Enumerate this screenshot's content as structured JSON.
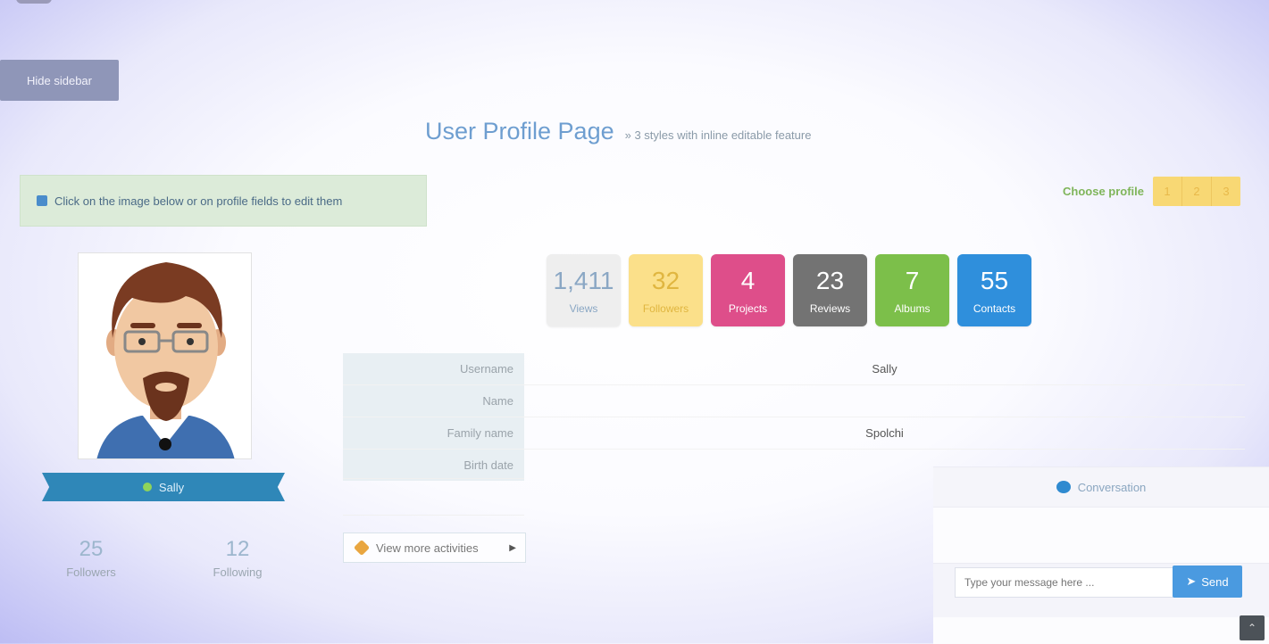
{
  "sidebar_toggle": {
    "label": "Hide sidebar"
  },
  "header": {
    "title": "User Profile Page",
    "subtitle": "» 3 styles with inline editable feature"
  },
  "alert": {
    "text": "Click on the image below or on profile fields to edit them"
  },
  "profile_switch": {
    "label": "Choose profile",
    "options": [
      "1",
      "2",
      "3"
    ]
  },
  "user": {
    "username": "Sally",
    "followers_count": "25",
    "followers_label": "Followers",
    "following_count": "12",
    "following_label": "Following"
  },
  "stats": [
    {
      "value": "1,411",
      "label": "Views",
      "bg": "#eeeeee",
      "fg": "#8aa7c4"
    },
    {
      "value": "32",
      "label": "Followers",
      "bg": "#fbe08a",
      "fg": "#e0b640"
    },
    {
      "value": "4",
      "label": "Projects",
      "bg": "#de4e8a",
      "fg": "#ffffff"
    },
    {
      "value": "23",
      "label": "Reviews",
      "bg": "#737373",
      "fg": "#ffffff"
    },
    {
      "value": "7",
      "label": "Albums",
      "bg": "#7cbf4a",
      "fg": "#ffffff"
    },
    {
      "value": "55",
      "label": "Contacts",
      "bg": "#2f8fdc",
      "fg": "#ffffff"
    }
  ],
  "profile_fields": [
    {
      "label": "Username",
      "value": "Sally"
    },
    {
      "label": "Name",
      "value": ""
    },
    {
      "label": "Family name",
      "value": "Spolchi"
    },
    {
      "label": "Birth date",
      "value": ""
    }
  ],
  "activities": {
    "label": "View more activities"
  },
  "conversation": {
    "title": "Conversation",
    "input_placeholder": "Type your message here ...",
    "send_label": "Send"
  }
}
